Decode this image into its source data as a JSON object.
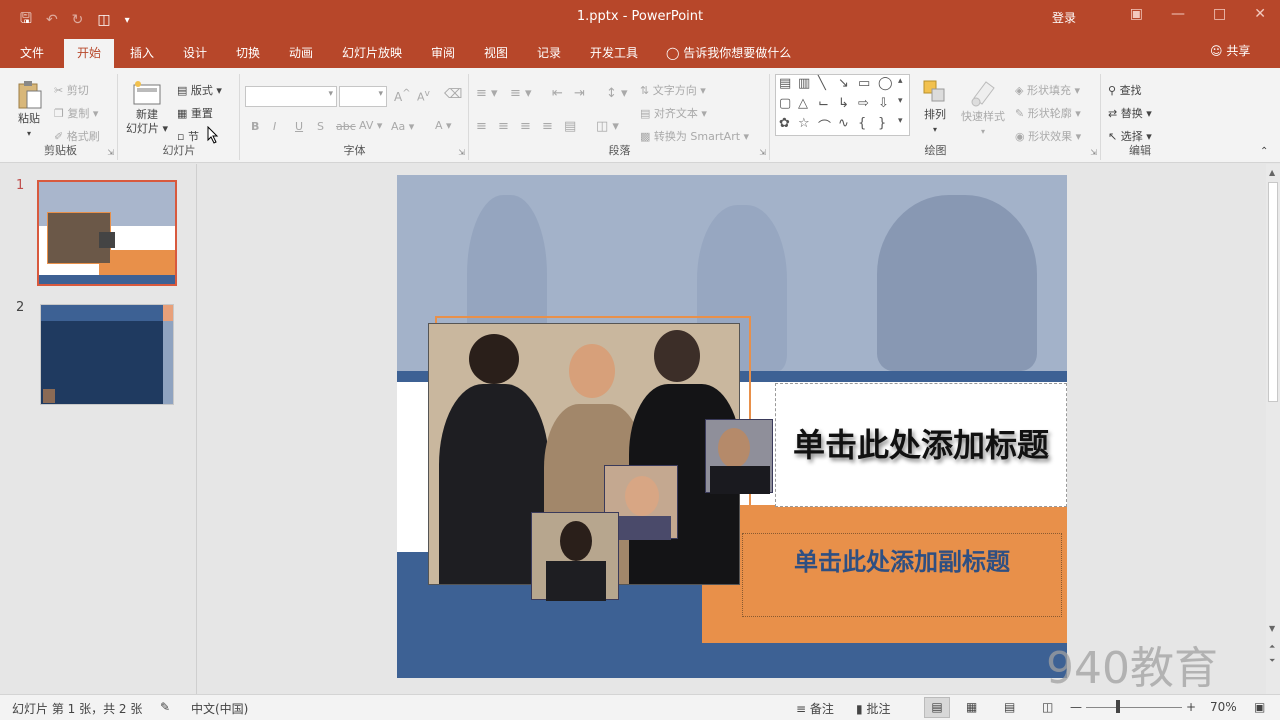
{
  "window": {
    "doc_title": "1.pptx  -  PowerPoint",
    "login": "登录",
    "share": "共享",
    "tell_me": "告诉我你想要做什么"
  },
  "tabs": [
    {
      "label": "文件"
    },
    {
      "label": "开始"
    },
    {
      "label": "插入"
    },
    {
      "label": "设计"
    },
    {
      "label": "切换"
    },
    {
      "label": "动画"
    },
    {
      "label": "幻灯片放映"
    },
    {
      "label": "审阅"
    },
    {
      "label": "视图"
    },
    {
      "label": "记录"
    },
    {
      "label": "开发工具"
    }
  ],
  "ribbon": {
    "clipboard": {
      "label": "剪贴板",
      "paste": "粘贴",
      "cut": "剪切",
      "copy": "复制",
      "format_painter": "格式刷"
    },
    "slides": {
      "label": "幻灯片",
      "new_slide_1": "新建",
      "new_slide_2": "幻灯片",
      "layout": "版式",
      "reset": "重置",
      "section": "节"
    },
    "font": {
      "label": "字体",
      "bold": "B",
      "italic": "I",
      "underline": "U",
      "shadow": "S",
      "strike": "abc",
      "grow": "A",
      "shrink": "A"
    },
    "paragraph": {
      "label": "段落",
      "text_direction": "文字方向",
      "align_text": "对齐文本",
      "smartart": "转换为 SmartArt"
    },
    "drawing": {
      "label": "绘图",
      "arrange": "排列",
      "quick_styles": "快速样式",
      "shape_fill": "形状填充",
      "shape_outline": "形状轮廓",
      "shape_effects": "形状效果"
    },
    "editing": {
      "label": "编辑",
      "find": "查找",
      "replace": "替换",
      "select": "选择"
    }
  },
  "slides_panel": [
    {
      "number": "1"
    },
    {
      "number": "2"
    }
  ],
  "slide": {
    "title": "单击此处添加标题",
    "subtitle": "单击此处添加副标题",
    "watermark": "940教育"
  },
  "status": {
    "slide_info": "幻灯片 第 1 张，共 2 张",
    "language": "中文(中国)",
    "notes": "备注",
    "comments": "批注",
    "zoom": "70%"
  },
  "colors": {
    "accent": "#b7472a",
    "slide_blue": "#3d6194",
    "slide_orange": "#e8904a",
    "slide_navy": "#1f3a60"
  }
}
